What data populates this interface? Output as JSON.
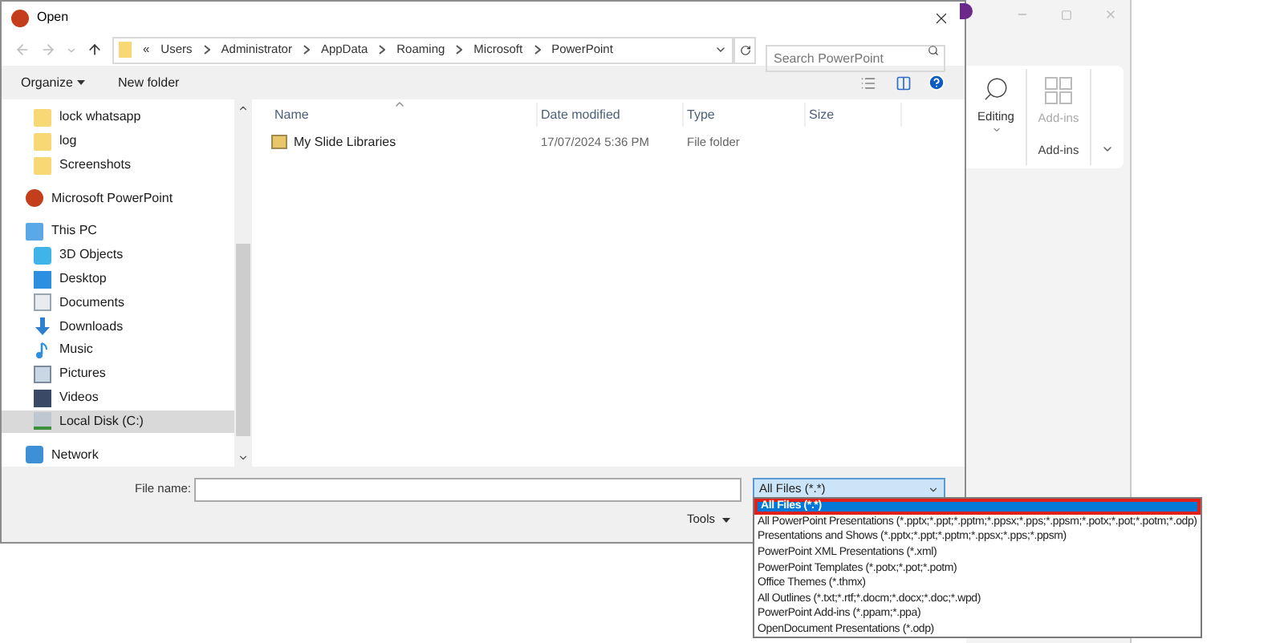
{
  "dialog": {
    "title": "Open",
    "path": [
      "«",
      "Users",
      "Administrator",
      "AppData",
      "Roaming",
      "Microsoft",
      "PowerPoint"
    ],
    "search": {
      "placeholder": "Search PowerPoint"
    }
  },
  "toolbar": {
    "organize": "Organize",
    "new_folder": "New folder"
  },
  "sidebar": {
    "items": [
      {
        "label": "lock whatsapp",
        "kind": "folder",
        "selected": false
      },
      {
        "label": "log",
        "kind": "folder",
        "selected": false
      },
      {
        "label": "Screenshots",
        "kind": "folder",
        "selected": false
      },
      {
        "label": "Microsoft PowerPoint",
        "kind": "app",
        "selected": false
      },
      {
        "label": "This PC",
        "kind": "pc",
        "selected": false,
        "children": [
          {
            "label": "3D Objects",
            "kind": "cube",
            "selected": false
          },
          {
            "label": "Desktop",
            "kind": "desktop",
            "selected": false
          },
          {
            "label": "Documents",
            "kind": "document",
            "selected": false
          },
          {
            "label": "Downloads",
            "kind": "download",
            "selected": false
          },
          {
            "label": "Music",
            "kind": "music",
            "selected": false
          },
          {
            "label": "Pictures",
            "kind": "picture",
            "selected": false
          },
          {
            "label": "Videos",
            "kind": "video",
            "selected": false
          },
          {
            "label": "Local Disk (C:)",
            "kind": "disk",
            "selected": true
          }
        ]
      },
      {
        "label": "Network",
        "kind": "network",
        "selected": false
      }
    ]
  },
  "table": {
    "columns": [
      "Name",
      "Date modified",
      "Type",
      "Size"
    ],
    "rows": [
      {
        "name": "My Slide Libraries",
        "date": "17/07/2024 5:36 PM",
        "type": "File folder"
      }
    ]
  },
  "footer": {
    "file_name_label": "File name:",
    "filter": "All Files (*.*)",
    "tools": "Tools"
  },
  "filter_dropdown": {
    "options": [
      {
        "label": "All Files (*.*)",
        "selected": true
      },
      {
        "label": "All PowerPoint Presentations (*.pptx;*.ppt;*.pptm;*.ppsx;*.pps;*.ppsm;*.potx;*.pot;*.potm;*.odp)",
        "selected": false
      },
      {
        "label": "Presentations and Shows (*.pptx;*.ppt;*.pptm;*.ppsx;*.pps;*.ppsm)",
        "selected": false
      },
      {
        "label": "PowerPoint XML Presentations (*.xml)",
        "selected": false
      },
      {
        "label": "PowerPoint Templates (*.potx;*.pot;*.potm)",
        "selected": false
      },
      {
        "label": "Office Themes (*.thmx)",
        "selected": false
      },
      {
        "label": "All Outlines (*.txt;*.rtf;*.docm;*.docx;*.doc;*.wpd)",
        "selected": false
      },
      {
        "label": "PowerPoint Add-ins (*.ppam;*.ppa)",
        "selected": false
      },
      {
        "label": "OpenDocument Presentations (*.odp)",
        "selected": false
      }
    ]
  },
  "ribbon": {
    "editing": "Editing",
    "addins_button": "Add-ins",
    "addins_group": "Add-ins"
  }
}
